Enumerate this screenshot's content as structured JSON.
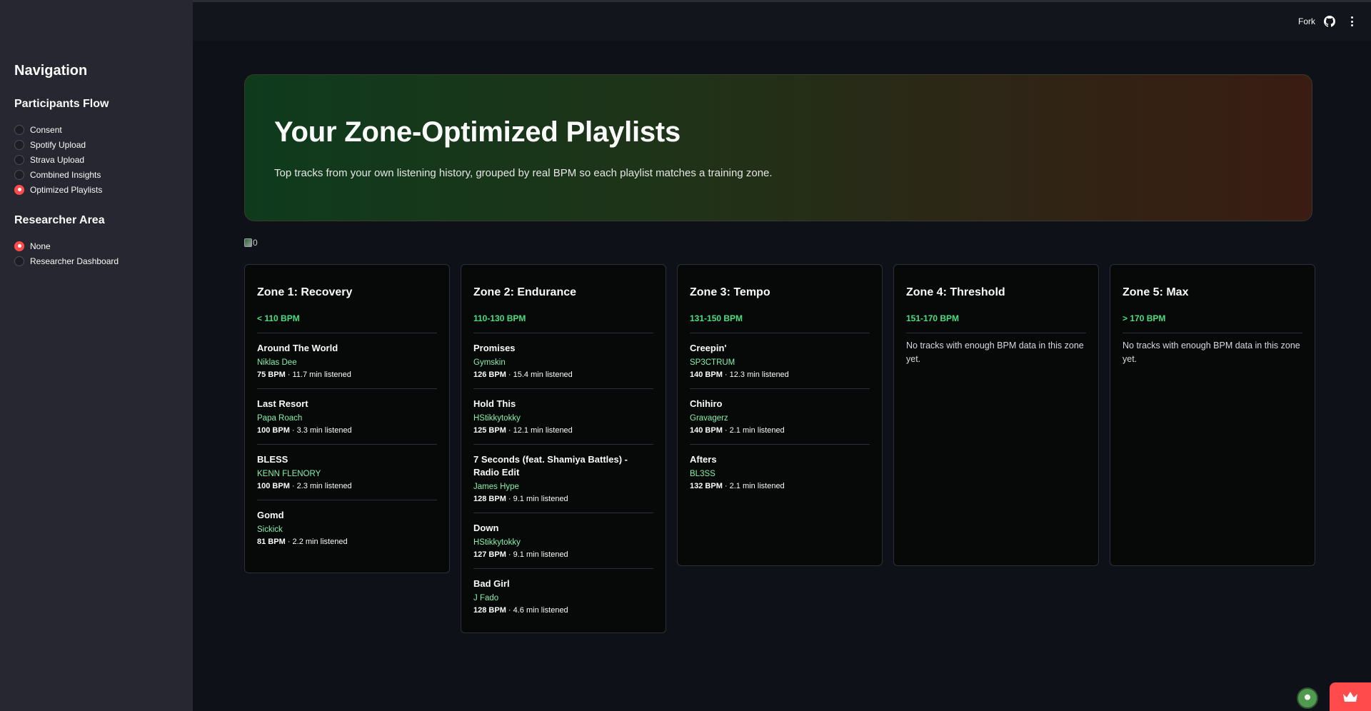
{
  "sidebar": {
    "title": "Navigation",
    "participants": {
      "heading": "Participants Flow",
      "options": [
        "Consent",
        "Spotify Upload",
        "Strava Upload",
        "Combined Insights",
        "Optimized Playlists"
      ],
      "selected": 4
    },
    "researcher": {
      "heading": "Researcher Area",
      "options": [
        "None",
        "Researcher Dashboard"
      ],
      "selected": 0
    }
  },
  "header": {
    "fork_label": "Fork",
    "github_icon": "github-icon",
    "menu_icon": "kebab-menu-icon"
  },
  "hero": {
    "title": "Your Zone-Optimized Playlists",
    "subtitle": "Top tracks from your own listening history, grouped by real BPM so each playlist matches a training zone."
  },
  "broken_image_alt": "0",
  "zones": [
    {
      "title": "Zone 1: Recovery",
      "bpm_range": "< 110 BPM",
      "tracks": [
        {
          "name": "Around The World",
          "artist": "Niklas Dee",
          "bpm": "75 BPM",
          "listened": " · 11.7 min listened"
        },
        {
          "name": "Last Resort",
          "artist": "Papa Roach",
          "bpm": "100 BPM",
          "listened": " · 3.3 min listened"
        },
        {
          "name": "BLESS",
          "artist": "KENN FLENORY",
          "bpm": "100 BPM",
          "listened": " · 2.3 min listened"
        },
        {
          "name": "Gomd",
          "artist": "Sickick",
          "bpm": "81 BPM",
          "listened": " · 2.2 min listened"
        }
      ]
    },
    {
      "title": "Zone 2: Endurance",
      "bpm_range": "110-130 BPM",
      "tracks": [
        {
          "name": "Promises",
          "artist": "Gymskin",
          "bpm": "126 BPM",
          "listened": " · 15.4 min listened"
        },
        {
          "name": "Hold This",
          "artist": "HStikkytokky",
          "bpm": "125 BPM",
          "listened": " · 12.1 min listened"
        },
        {
          "name": "7 Seconds (feat. Shamiya Battles) - Radio Edit",
          "artist": "James Hype",
          "bpm": "128 BPM",
          "listened": " · 9.1 min listened"
        },
        {
          "name": "Down",
          "artist": "HStikkytokky",
          "bpm": "127 BPM",
          "listened": " · 9.1 min listened"
        },
        {
          "name": "Bad Girl",
          "artist": "J Fado",
          "bpm": "128 BPM",
          "listened": " · 4.6 min listened"
        }
      ]
    },
    {
      "title": "Zone 3: Tempo",
      "bpm_range": "131-150 BPM",
      "tracks": [
        {
          "name": "Creepin'",
          "artist": "SP3CTRUM",
          "bpm": "140 BPM",
          "listened": " · 12.3 min listened"
        },
        {
          "name": "Chihiro",
          "artist": "Gravagerz",
          "bpm": "140 BPM",
          "listened": " · 2.1 min listened"
        },
        {
          "name": "Afters",
          "artist": "BL3SS",
          "bpm": "132 BPM",
          "listened": " · 2.1 min listened"
        }
      ]
    },
    {
      "title": "Zone 4: Threshold",
      "bpm_range": "151-170 BPM",
      "empty_message": "No tracks with enough BPM data in this zone yet.",
      "tracks": []
    },
    {
      "title": "Zone 5: Max",
      "bpm_range": "> 170 BPM",
      "empty_message": "No tracks with enough BPM data in this zone yet.",
      "tracks": []
    }
  ],
  "colors": {
    "accent": "#ff4b4b",
    "bpm_green": "#4ade80",
    "artist_green": "#86efac"
  }
}
